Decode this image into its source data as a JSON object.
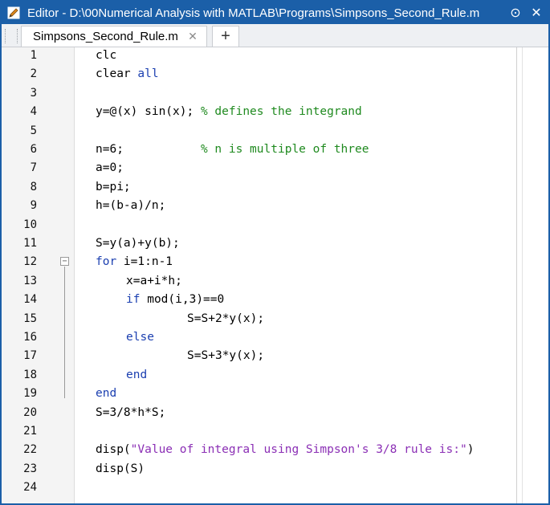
{
  "window": {
    "title": "Editor - D:\\00Numerical Analysis with MATLAB\\Programs\\Simpsons_Second_Rule.m",
    "accent": "#1b5fa8"
  },
  "tabs": [
    {
      "label": "Simpsons_Second_Rule.m",
      "close_glyph": "✕"
    }
  ],
  "tab_add_glyph": "+",
  "title_buttons": {
    "menu_glyph": "⊙",
    "close_glyph": "✕"
  },
  "colors": {
    "keyword": "#1b3fb0",
    "comment": "#1f8a1f",
    "string": "#8b2fb5"
  },
  "lines": [
    {
      "n": "1",
      "indent": 0,
      "parts": [
        {
          "t": "clc"
        }
      ]
    },
    {
      "n": "2",
      "indent": 0,
      "parts": [
        {
          "t": "clear "
        },
        {
          "t": "all",
          "c": "kw"
        }
      ]
    },
    {
      "n": "3",
      "indent": 0,
      "parts": []
    },
    {
      "n": "4",
      "indent": 0,
      "parts": [
        {
          "t": "y=@(x) sin(x); "
        },
        {
          "t": "% defines the integrand",
          "c": "cm"
        }
      ]
    },
    {
      "n": "5",
      "indent": 0,
      "parts": []
    },
    {
      "n": "6",
      "indent": 0,
      "parts": [
        {
          "t": "n=6;           "
        },
        {
          "t": "% n is multiple of three",
          "c": "cm"
        }
      ]
    },
    {
      "n": "7",
      "indent": 0,
      "parts": [
        {
          "t": "a=0;"
        }
      ]
    },
    {
      "n": "8",
      "indent": 0,
      "parts": [
        {
          "t": "b=pi;"
        }
      ]
    },
    {
      "n": "9",
      "indent": 0,
      "parts": [
        {
          "t": "h=(b-a)/n;"
        }
      ]
    },
    {
      "n": "10",
      "indent": 0,
      "parts": []
    },
    {
      "n": "11",
      "indent": 0,
      "parts": [
        {
          "t": "S=y(a)+y(b);"
        }
      ]
    },
    {
      "n": "12",
      "indent": 0,
      "fold": true,
      "parts": [
        {
          "t": "for",
          "c": "kw"
        },
        {
          "t": " i=1:n-1"
        }
      ]
    },
    {
      "n": "13",
      "indent": 1,
      "parts": [
        {
          "t": "x=a+i*h;"
        }
      ]
    },
    {
      "n": "14",
      "indent": 1,
      "parts": [
        {
          "t": "if",
          "c": "kw"
        },
        {
          "t": " mod(i,3)==0"
        }
      ]
    },
    {
      "n": "15",
      "indent": 3,
      "parts": [
        {
          "t": "S=S+2*y(x);"
        }
      ]
    },
    {
      "n": "16",
      "indent": 1,
      "parts": [
        {
          "t": "else",
          "c": "kw"
        }
      ]
    },
    {
      "n": "17",
      "indent": 3,
      "parts": [
        {
          "t": "S=S+3*y(x);"
        }
      ]
    },
    {
      "n": "18",
      "indent": 1,
      "parts": [
        {
          "t": "end",
          "c": "kw"
        }
      ]
    },
    {
      "n": "19",
      "indent": 0,
      "parts": [
        {
          "t": "end",
          "c": "kw"
        }
      ]
    },
    {
      "n": "20",
      "indent": 0,
      "parts": [
        {
          "t": "S=3/8*h*S;"
        }
      ]
    },
    {
      "n": "21",
      "indent": 0,
      "parts": []
    },
    {
      "n": "22",
      "indent": 0,
      "parts": [
        {
          "t": "disp("
        },
        {
          "t": "\"Value of integral using Simpson's 3/8 rule is:\"",
          "c": "st"
        },
        {
          "t": ")"
        }
      ]
    },
    {
      "n": "23",
      "indent": 0,
      "parts": [
        {
          "t": "disp(S)"
        }
      ]
    },
    {
      "n": "24",
      "indent": 0,
      "parts": []
    }
  ]
}
